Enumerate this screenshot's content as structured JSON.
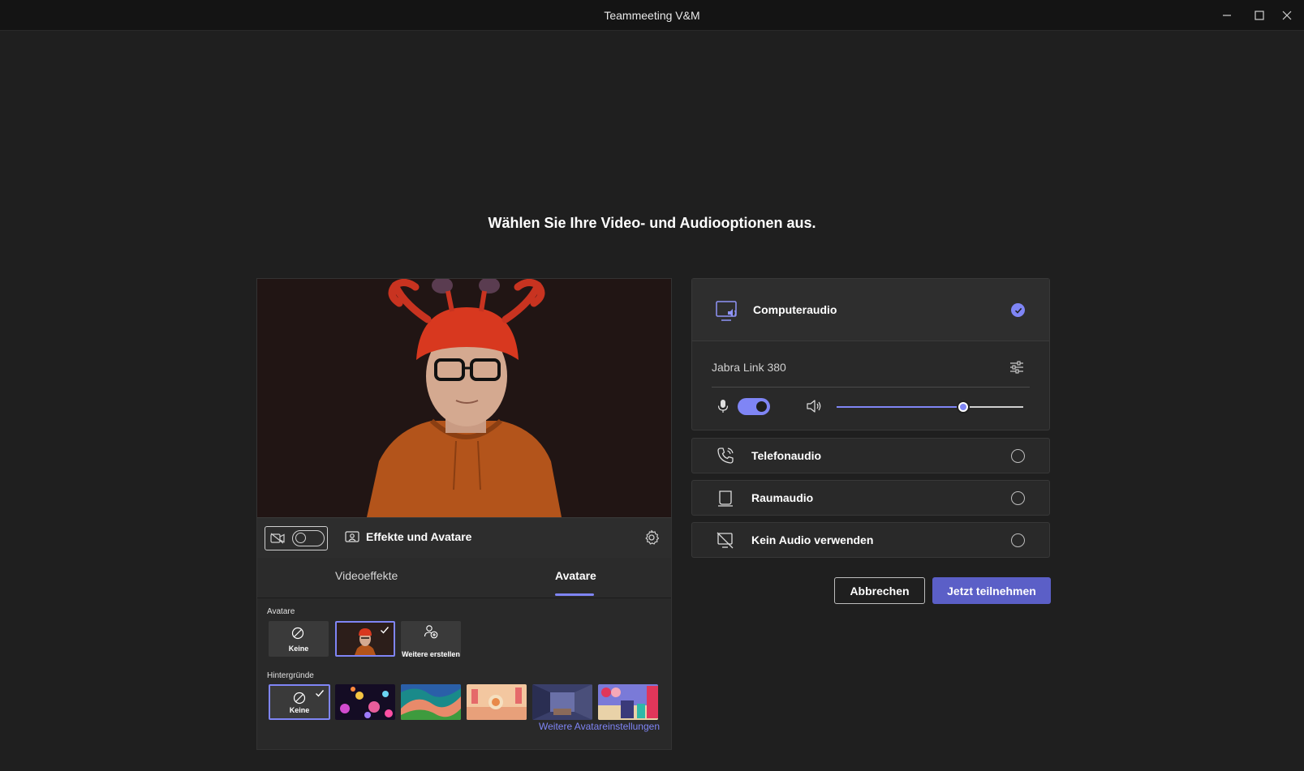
{
  "window": {
    "title": "Teammeeting V&M"
  },
  "heading": "Wählen Sie Ihre Video- und Audiooptionen aus.",
  "video": {
    "effects_label": "Effekte und Avatare",
    "tabs": [
      {
        "label": "Videoeffekte",
        "active": false
      },
      {
        "label": "Avatare",
        "active": true
      }
    ],
    "avatars_section": "Avatare",
    "avatar_tiles": [
      {
        "label": "Keine",
        "selected": false
      },
      {
        "label": "",
        "selected": true
      },
      {
        "label": "Weitere erstellen",
        "selected": false
      }
    ],
    "backgrounds_section": "Hintergründe",
    "background_tiles": [
      {
        "label": "Keine",
        "selected": true
      }
    ],
    "more_link": "Weitere Avatareinstellungen"
  },
  "audio": {
    "options": [
      {
        "label": "Computeraudio",
        "selected": true
      },
      {
        "label": "Telefonaudio",
        "selected": false
      },
      {
        "label": "Raumaudio",
        "selected": false
      },
      {
        "label": "Kein Audio verwenden",
        "selected": false
      }
    ],
    "device_name": "Jabra Link 380",
    "mic_enabled": true,
    "speaker_volume_fraction": 0.68
  },
  "buttons": {
    "cancel": "Abbrechen",
    "join": "Jetzt teilnehmen"
  },
  "colors": {
    "accent": "#7f85f5",
    "join_button": "#5b5fc7",
    "background": "#1f1f1f"
  }
}
